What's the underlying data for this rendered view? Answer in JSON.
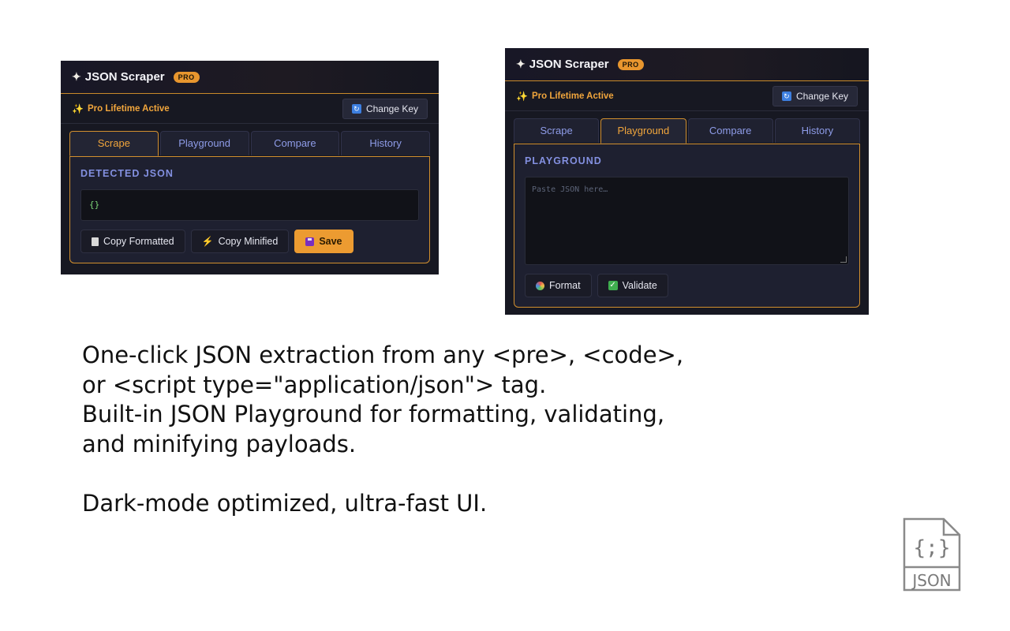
{
  "panel_scrape": {
    "brand": "JSON Scraper",
    "badge": "PRO",
    "status": "Pro Lifetime Active",
    "change_key": "Change Key",
    "tabs": [
      {
        "label": "Scrape",
        "active": true
      },
      {
        "label": "Playground",
        "active": false
      },
      {
        "label": "Compare",
        "active": false
      },
      {
        "label": "History",
        "active": false
      }
    ],
    "section_label": "DETECTED JSON",
    "json_content": "{}",
    "buttons": {
      "copy_formatted": "Copy Formatted",
      "copy_minified": "Copy Minified",
      "save": "Save"
    }
  },
  "panel_playground": {
    "brand": "JSON Scraper",
    "badge": "PRO",
    "status": "Pro Lifetime Active",
    "change_key": "Change Key",
    "tabs": [
      {
        "label": "Scrape",
        "active": false
      },
      {
        "label": "Playground",
        "active": true
      },
      {
        "label": "Compare",
        "active": false
      },
      {
        "label": "History",
        "active": false
      }
    ],
    "section_label": "PLAYGROUND",
    "textarea_placeholder": "Paste JSON here…",
    "buttons": {
      "format": "Format",
      "validate": "Validate"
    }
  },
  "description": {
    "line1": "One-click JSON extraction from any <pre>, <code>,",
    "line2": "or <script type=\"application/json\"> tag.",
    "line3": "Built-in JSON Playground for formatting, validating,",
    "line4": "and minifying payloads.",
    "line5": "Dark-mode optimized, ultra-fast UI."
  },
  "file_icon": {
    "braces": "{;}",
    "label": "JSON"
  },
  "colors": {
    "accent_orange": "#ec9b31",
    "panel_bg": "#171822",
    "tab_blue": "#8e9ce8"
  }
}
